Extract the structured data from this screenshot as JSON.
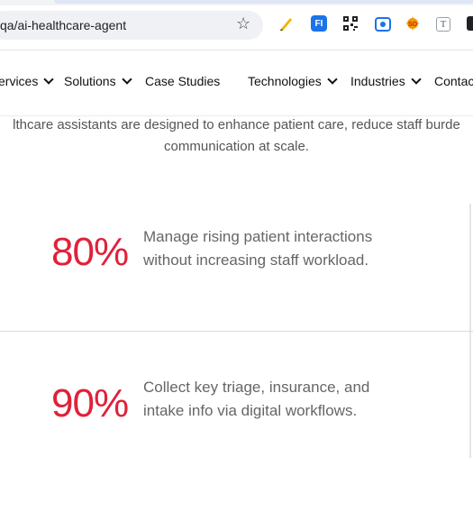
{
  "browser": {
    "url": "qa/ai-healthcare-agent",
    "extensions": [
      "pen-extension-icon",
      "fi-extension-icon",
      "qr-code-extension-icon",
      "record-extension-icon",
      "so-extension-icon",
      "t-extension-icon",
      "profile-extension-icon"
    ],
    "ext_fi_label": "FI",
    "ext_t_label": "T"
  },
  "nav": {
    "services": "ervices",
    "solutions": "Solutions",
    "case_studies": "Case Studies",
    "technologies": "Technologies",
    "industries": "Industries",
    "contact": "Contac"
  },
  "intro": {
    "line1": "lthcare assistants are designed to enhance patient care, reduce staff burde",
    "line2": "communication at scale."
  },
  "stats": [
    {
      "value": "80%",
      "line1": "Manage rising patient interactions",
      "line2": "without increasing staff workload."
    },
    {
      "value": "90%",
      "line1": "Collect key triage, insurance, and",
      "line2": "intake info via digital workflows."
    }
  ],
  "colors": {
    "accent": "#e0213a",
    "text": "#666666"
  }
}
